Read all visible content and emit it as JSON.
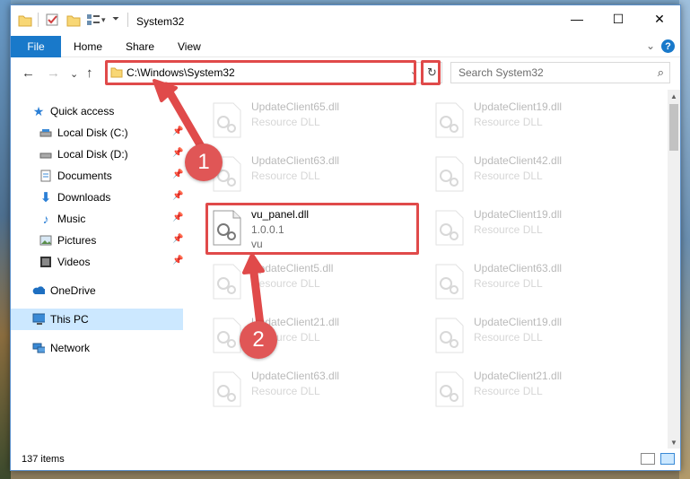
{
  "window": {
    "title": "System32",
    "minimize": "—",
    "maximize": "☐",
    "close": "✕"
  },
  "ribbon": {
    "file": "File",
    "tabs": [
      "Home",
      "Share",
      "View"
    ],
    "expand": "⌄",
    "help": "?"
  },
  "navigation": {
    "back": "←",
    "forward": "→",
    "recent": "⌄",
    "up": "↑",
    "address": "C:\\Windows\\System32",
    "search_placeholder": "Search System32"
  },
  "sidebar": {
    "items": [
      {
        "label": "Quick access",
        "icon": "star-icon"
      },
      {
        "label": "Local Disk (C:)",
        "icon": "drive-icon"
      },
      {
        "label": "Local Disk (D:)",
        "icon": "drive-icon"
      },
      {
        "label": "Documents",
        "icon": "documents-icon"
      },
      {
        "label": "Downloads",
        "icon": "download-icon"
      },
      {
        "label": "Music",
        "icon": "music-icon"
      },
      {
        "label": "Pictures",
        "icon": "pictures-icon"
      },
      {
        "label": "Videos",
        "icon": "videos-icon"
      },
      {
        "label": "OneDrive",
        "icon": "cloud-icon"
      },
      {
        "label": "This PC",
        "icon": "computer-icon"
      },
      {
        "label": "Network",
        "icon": "network-icon"
      }
    ]
  },
  "files": [
    {
      "name": "UpdateClient65.dll",
      "type": "Resource DLL"
    },
    {
      "name": "UpdateClient19.dll",
      "type": "Resource DLL"
    },
    {
      "name": "UpdateClient63.dll",
      "type": "Resource DLL"
    },
    {
      "name": "UpdateClient42.dll",
      "type": "Resource DLL"
    },
    {
      "name": "vu_panel.dll",
      "version": "1.0.0.1",
      "company": "vu"
    },
    {
      "name": "UpdateClient19.dll",
      "type": "Resource DLL"
    },
    {
      "name": "UpdateClient5.dll",
      "type": "Resource DLL"
    },
    {
      "name": "UpdateClient63.dll",
      "type": "Resource DLL"
    },
    {
      "name": "UpdateClient21.dll",
      "type": "Resource DLL"
    },
    {
      "name": "UpdateClient19.dll",
      "type": "Resource DLL"
    },
    {
      "name": "UpdateClient63.dll",
      "type": "Resource DLL"
    },
    {
      "name": "UpdateClient21.dll",
      "type": "Resource DLL"
    }
  ],
  "status": {
    "item_count": "137 items"
  },
  "annotations": {
    "step1": "1",
    "step2": "2",
    "color": "#e04a4a"
  }
}
